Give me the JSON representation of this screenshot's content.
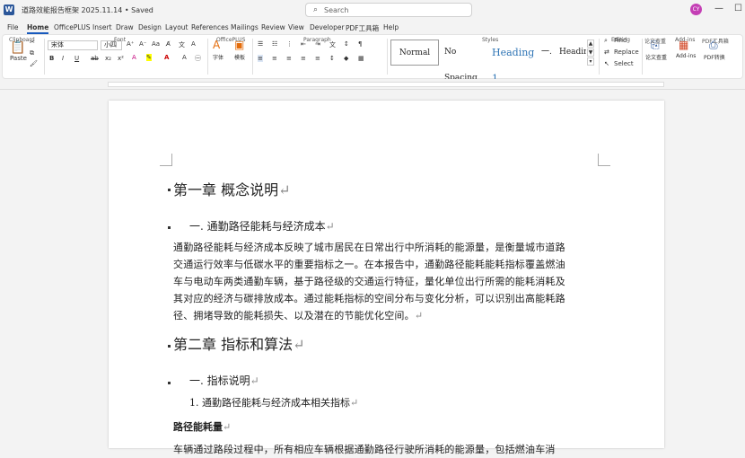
{
  "titlebar": {
    "doc_title": "道路效能报告框架  2025.11.14 • Saved",
    "search_placeholder": "Search",
    "avatar": "CY"
  },
  "tabs": [
    "File",
    "Home",
    "OfficePLUS",
    "Insert",
    "Draw",
    "Design",
    "Layout",
    "References",
    "Mailings",
    "Review",
    "View",
    "Developer",
    "PDF工具箱",
    "Help"
  ],
  "ribbon": {
    "paste": "Paste",
    "font_name": "宋体",
    "font_size": "小四",
    "font_buttons": [
      "B",
      "I",
      "U",
      "ab",
      "x₂",
      "x²",
      "A"
    ],
    "officeplus_1": "字体",
    "officeplus_2": "模板",
    "styles": [
      "Normal",
      "No Spacing",
      "Heading 1",
      "一.",
      "Headin"
    ],
    "find": "Find",
    "replace": "Replace",
    "select": "Select",
    "review_label": "论文查重",
    "addins_label": "Add-ins",
    "pdf_label": "PDF转换",
    "groups": [
      "Clipboard",
      "Font",
      "OfficePLUS",
      "Paragraph",
      "Styles",
      "Editing",
      "论文查重",
      "Add-ins",
      "PDF工具箱"
    ]
  },
  "document": {
    "chapter1": "第一章  概念说明",
    "section1": "一. 通勤路径能耗与经济成本",
    "para1": [
      "通勤路径能耗与经济成本反映了城市居民在日常出行中所消耗的能源量，是衡量城市道路",
      "交通运行效率与低碳水平的重要指标之一。在本报告中，通勤路径能耗能耗指标覆盖燃油",
      "车与电动车两类通勤车辆，基于路径级的交通运行特征，量化单位出行所需的能耗消耗及",
      "其对应的经济与碳排放成本。通过能耗指标的空间分布与变化分析，可以识别出高能耗路",
      "径、拥堵导致的能耗损失、以及潜在的节能优化空间。"
    ],
    "chapter2": "第二章  指标和算法",
    "section2": "一. 指标说明",
    "item1": "1.  通勤路径能耗与经济成本相关指标",
    "subhead": "路径能耗量",
    "para2": "车辆通过路段过程中，所有相应车辆根据通勤路径行驶所消耗的能源量，包括燃油车消",
    "mark": "↵"
  }
}
